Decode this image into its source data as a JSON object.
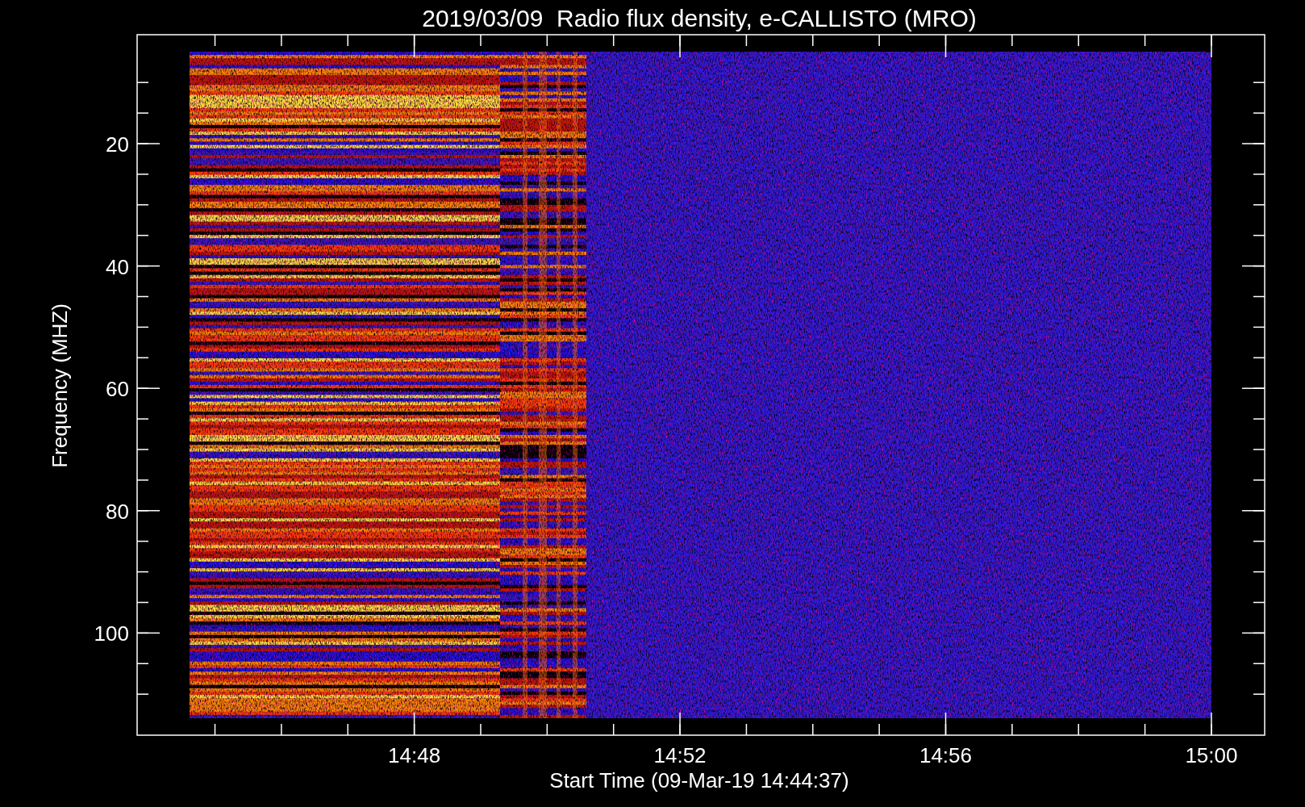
{
  "title": "2019/03/09  Radio flux density, e-CALLISTO (MRO)",
  "plot": {
    "ylabel": "Frequency (MHZ)",
    "xlabel": "Start Time (09-Mar-19 14:44:37)",
    "y_tick_labels": [
      "20",
      "40",
      "60",
      "80",
      "100"
    ],
    "x_tick_labels": [
      "14:48",
      "14:52",
      "14:56",
      "15:00"
    ]
  }
}
